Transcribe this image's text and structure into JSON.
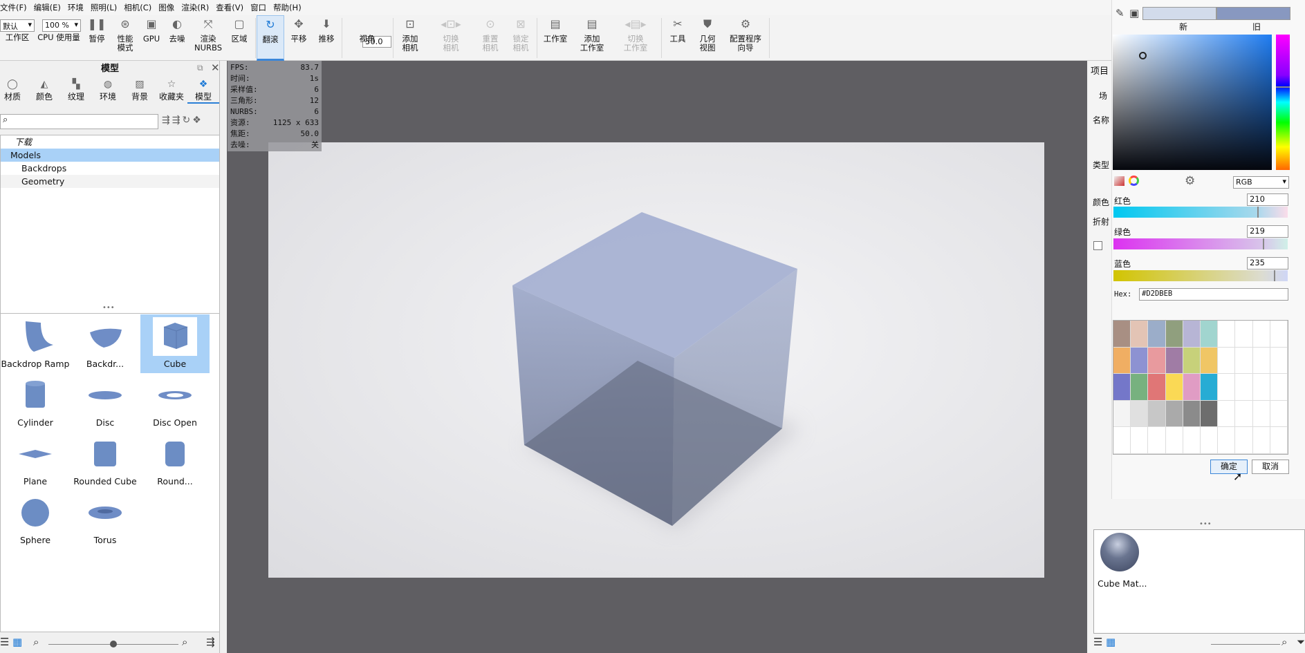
{
  "menu": [
    "文件(F)",
    "编辑(E)",
    "环境",
    "照明(L)",
    "相机(C)",
    "图像",
    "渲染(R)",
    "查看(V)",
    "窗口",
    "帮助(H)"
  ],
  "toolbar": {
    "workspace_select": "默认",
    "cpu_select": "100 %",
    "fov_value": "50.0",
    "items": [
      {
        "label": "工作区",
        "icon": "workspace-icon",
        "glyph": "",
        "state": ""
      },
      {
        "label": "CPU 使用量",
        "icon": "cpu-icon",
        "glyph": "",
        "state": ""
      },
      {
        "label": "暂停",
        "icon": "pause-icon",
        "glyph": "❚❚",
        "state": ""
      },
      {
        "label": "性能\n模式",
        "icon": "performance-icon",
        "glyph": "⊛",
        "state": ""
      },
      {
        "label": "GPU",
        "icon": "gpu-icon",
        "glyph": "▣",
        "state": ""
      },
      {
        "label": "去噪",
        "icon": "denoise-icon",
        "glyph": "◐",
        "state": ""
      },
      {
        "label": "渲染\nNURBS",
        "icon": "nurbs-icon",
        "glyph": "⤧",
        "state": ""
      },
      {
        "label": "区域",
        "icon": "region-icon",
        "glyph": "▢",
        "state": ""
      },
      {
        "label": "翻滚",
        "icon": "tumble-icon",
        "glyph": "↻",
        "state": "active"
      },
      {
        "label": "平移",
        "icon": "pan-icon",
        "glyph": "✥",
        "state": ""
      },
      {
        "label": "推移",
        "icon": "dolly-icon",
        "glyph": "⬇",
        "state": ""
      },
      {
        "label": "视角",
        "icon": "fov-icon",
        "glyph": "",
        "state": ""
      },
      {
        "label": "添加\n相机",
        "icon": "add-camera-icon",
        "glyph": "⊡",
        "state": ""
      },
      {
        "label": "切换\n相机",
        "icon": "switch-camera-icon",
        "glyph": "◂⊡▸",
        "state": "disabled"
      },
      {
        "label": "重置\n相机",
        "icon": "reset-camera-icon",
        "glyph": "⊙",
        "state": "disabled"
      },
      {
        "label": "锁定\n相机",
        "icon": "lock-camera-icon",
        "glyph": "⊠",
        "state": "disabled"
      },
      {
        "label": "工作室",
        "icon": "studio-icon",
        "glyph": "▤",
        "state": ""
      },
      {
        "label": "添加\n工作室",
        "icon": "add-studio-icon",
        "glyph": "▤",
        "state": ""
      },
      {
        "label": "切换\n工作室",
        "icon": "switch-studio-icon",
        "glyph": "◂▤▸",
        "state": "disabled"
      },
      {
        "label": "工具",
        "icon": "tools-icon",
        "glyph": "✂",
        "state": ""
      },
      {
        "label": "几何\n视图",
        "icon": "geometry-view-icon",
        "glyph": "⛊",
        "state": ""
      },
      {
        "label": "配置程序\n向导",
        "icon": "configurator-wizard-icon",
        "glyph": "⚙",
        "state": ""
      }
    ]
  },
  "left_panel": {
    "title": "模型",
    "tabs": [
      {
        "label": "材质",
        "icon": "material-icon",
        "glyph": "◯"
      },
      {
        "label": "颜色",
        "icon": "color-icon",
        "glyph": "◭"
      },
      {
        "label": "纹理",
        "icon": "texture-icon",
        "glyph": "▚"
      },
      {
        "label": "环境",
        "icon": "environment-icon",
        "glyph": "◍"
      },
      {
        "label": "背景",
        "icon": "background-icon",
        "glyph": "▨"
      },
      {
        "label": "收藏夹",
        "icon": "favorites-icon",
        "glyph": "☆"
      },
      {
        "label": "模型",
        "icon": "models-icon",
        "glyph": "❖"
      }
    ],
    "active_tab": "模型",
    "search_placeholder": "",
    "tree": [
      "下载",
      "Models",
      "Backdrops",
      "Geometry"
    ],
    "models": [
      "Backdrop Ramp",
      "Backdr...",
      "Cube",
      "Cylinder",
      "Disc",
      "Disc Open",
      "Plane",
      "Rounded Cube",
      "Round...",
      "Sphere",
      "Torus"
    ],
    "selected_model": "Cube",
    "zoom_slider": 0.5
  },
  "stats": [
    {
      "k": "FPS:",
      "v": "83.7"
    },
    {
      "k": "时间:",
      "v": "1s"
    },
    {
      "k": "采样值:",
      "v": "6"
    },
    {
      "k": "三角形:",
      "v": "12"
    },
    {
      "k": "NURBS:",
      "v": "6"
    },
    {
      "k": "资源:",
      "v": "1125 x 633"
    },
    {
      "k": "焦距:",
      "v": "50.0"
    },
    {
      "k": "去噪:",
      "v": "关"
    }
  ],
  "right_panel": {
    "tab": "项目",
    "sub": "场",
    "labels": [
      "名称",
      "类型",
      "颜色",
      "折射"
    ],
    "material_label": "Cube Mat..."
  },
  "picker": {
    "new_label": "新",
    "old_label": "旧",
    "new_color": "#D2DBEB",
    "old_color": "#8898C0",
    "mode": "RGB",
    "red_label": "红色",
    "red": "210",
    "green_label": "绿色",
    "green": "219",
    "blue_label": "蓝色",
    "blue": "235",
    "hex_label": "Hex:",
    "hex": "#D2DBEB",
    "ok": "确定",
    "cancel": "取消",
    "swatches": [
      [
        "#a88f83",
        "#e3c4b5",
        "#9badc9",
        "#909f7e",
        "#b7b5d5",
        "#a1d5cf"
      ],
      [
        "#f0ae63",
        "#8d92d2",
        "#e89a9e",
        "#a07ca5",
        "#c7d17a",
        "#f0c665"
      ],
      [
        "#7477c9",
        "#77b17f",
        "#e07676",
        "#fad955",
        "#e09cc4",
        "#27acd4"
      ],
      [
        "#f4f4f4",
        "#e0e0e0",
        "#c7c7c7",
        "#aaaaaa",
        "#8b8b8b",
        "#6d6d6d"
      ]
    ]
  }
}
